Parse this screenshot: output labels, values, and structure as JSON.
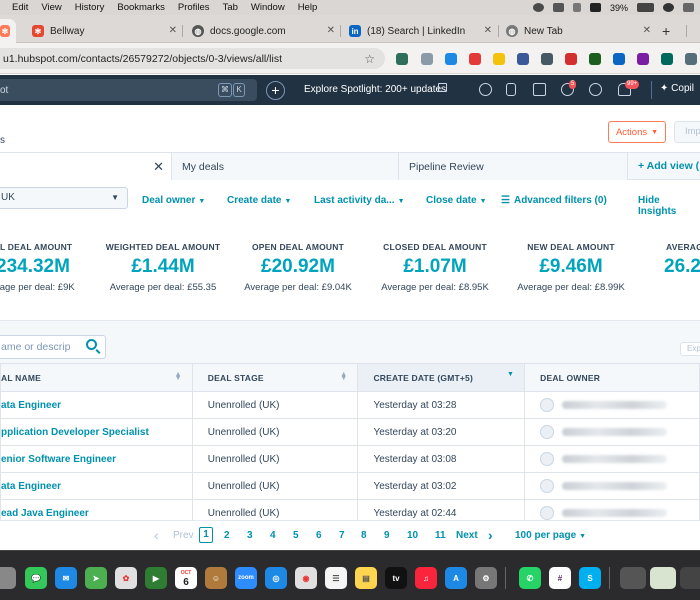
{
  "menubar": {
    "items": [
      "Edit",
      "View",
      "History",
      "Bookmarks",
      "Profiles",
      "Tab",
      "Window",
      "Help"
    ],
    "battery": "39%"
  },
  "tabs": [
    {
      "label": "",
      "active": false
    },
    {
      "label": "Bellway",
      "active": false
    },
    {
      "label": "docs.google.com",
      "active": false
    },
    {
      "label": "(18) Search | LinkedIn",
      "active": false
    },
    {
      "label": "New Tab",
      "active": false
    }
  ],
  "address": {
    "url": "u1.hubspot.com/contacts/26579272/objects/0-3/views/all/list"
  },
  "hubspot_nav": {
    "search_text": "ot",
    "shortcut_keys": [
      "⌘",
      "K"
    ],
    "spotlight": "Explore Spotlight: 200+ updates",
    "notif_badge_1": "5",
    "notif_badge_2": "99+",
    "copilot": "Copil"
  },
  "header": {
    "crumb": "s",
    "actions_label": "Actions",
    "import_label": "Imp"
  },
  "views": {
    "tabs": [
      "",
      "My deals",
      "Pipeline Review"
    ],
    "add_view": "Add view ("
  },
  "filters": {
    "pipeline": "UK",
    "items": [
      "Deal owner",
      "Create date",
      "Last activity da...",
      "Close date"
    ],
    "advanced": "Advanced filters (0)",
    "hide_insights": "Hide Insights"
  },
  "summary": [
    {
      "label": "AL DEAL AMOUNT",
      "value": "234.32M",
      "avg": "erage per deal: £9K"
    },
    {
      "label": "WEIGHTED DEAL AMOUNT",
      "value": "£1.44M",
      "avg": "Average per deal: £55.35"
    },
    {
      "label": "OPEN DEAL AMOUNT",
      "value": "£20.92M",
      "avg": "Average per deal: £9.04K"
    },
    {
      "label": "CLOSED DEAL AMOUNT",
      "value": "£1.07M",
      "avg": "Average per deal: £8.95K"
    },
    {
      "label": "NEW DEAL AMOUNT",
      "value": "£9.46M",
      "avg": "Average per deal: £8.99K"
    },
    {
      "label": "AVERAG",
      "value": "26.2",
      "avg": ""
    }
  ],
  "table": {
    "search_placeholder": "ame or descrip",
    "export_label": "Exp",
    "columns": [
      "AL NAME",
      "DEAL STAGE",
      "CREATE DATE (GMT+5)",
      "DEAL OWNER"
    ],
    "rows": [
      {
        "name": "ata Engineer",
        "stage": "Unenrolled (UK)",
        "date": "Yesterday at 03:28"
      },
      {
        "name": "pplication Developer Specialist",
        "stage": "Unenrolled (UK)",
        "date": "Yesterday at 03:20"
      },
      {
        "name": "enior Software Engineer",
        "stage": "Unenrolled (UK)",
        "date": "Yesterday at 03:08"
      },
      {
        "name": "ata Engineer",
        "stage": "Unenrolled (UK)",
        "date": "Yesterday at 03:02"
      },
      {
        "name": "ead Java Engineer",
        "stage": "Unenrolled (UK)",
        "date": "Yesterday at 02:44"
      }
    ]
  },
  "pagination": {
    "prev": "Prev",
    "pages": [
      "1",
      "2",
      "3",
      "4",
      "5",
      "6",
      "7",
      "8",
      "9",
      "10",
      "11"
    ],
    "next": "Next",
    "per_page": "100 per page"
  },
  "dock": {
    "calendar_month": "OCT",
    "calendar_day": "6",
    "zoom_label": "zoom"
  }
}
